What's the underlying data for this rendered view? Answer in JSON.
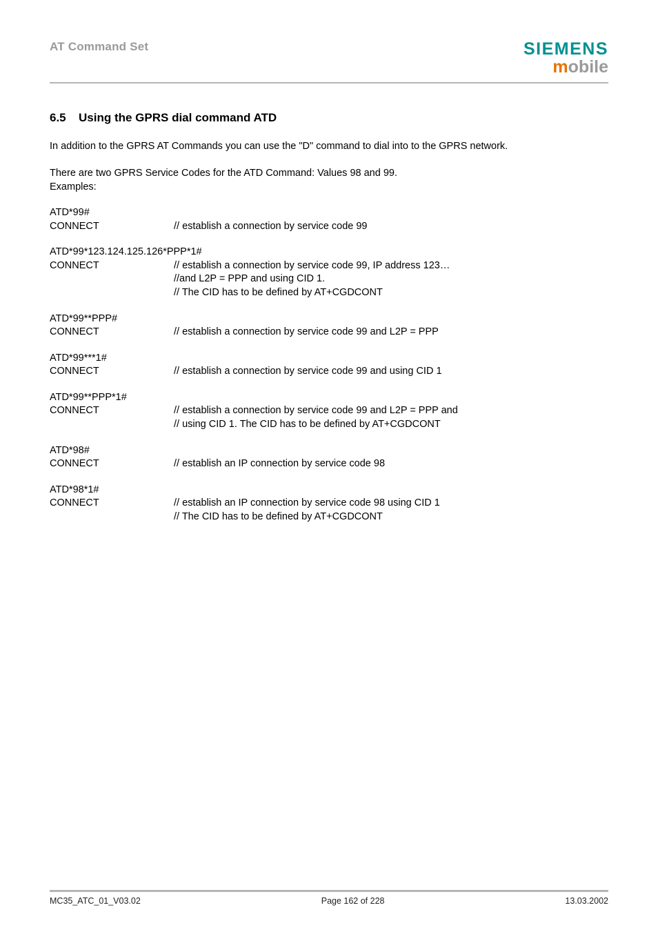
{
  "header": {
    "title": "AT Command Set",
    "logo_top": "SIEMENS",
    "logo_m": "m",
    "logo_rest": "obile"
  },
  "section": {
    "number": "6.5",
    "title": "Using the GPRS dial command ATD"
  },
  "intro": "In addition to the GPRS AT Commands you can use the \"D\" command to dial into to the GPRS network.",
  "note_line1": "There are two GPRS Service Codes for the ATD Command: Values 98 and 99.",
  "note_line2": "Examples:",
  "examples": [
    {
      "cmd": "ATD*99#",
      "rows": [
        {
          "left": "CONNECT",
          "right": "// establish a connection by service code 99"
        }
      ]
    },
    {
      "cmd": "ATD*99*123.124.125.126*PPP*1#",
      "rows": [
        {
          "left": "CONNECT",
          "right": "// establish a connection by service code 99, IP address 123…"
        },
        {
          "left": "",
          "right": "//and L2P = PPP and using CID 1."
        },
        {
          "left": "",
          "right": "// The CID has to be defined by AT+CGDCONT"
        }
      ]
    },
    {
      "cmd": "ATD*99**PPP#",
      "rows": [
        {
          "left": "CONNECT",
          "right": "// establish a connection by service code 99 and L2P = PPP"
        }
      ]
    },
    {
      "cmd": "ATD*99***1#",
      "rows": [
        {
          "left": "CONNECT",
          "right": "// establish a connection by service code 99 and using CID 1"
        }
      ]
    },
    {
      "cmd": "ATD*99**PPP*1#",
      "rows": [
        {
          "left": "CONNECT",
          "right": "// establish a connection by service code 99 and L2P = PPP and"
        },
        {
          "left": "",
          "right": "// using CID 1. The CID has to be defined by AT+CGDCONT"
        }
      ]
    },
    {
      "cmd": "ATD*98#",
      "rows": [
        {
          "left": "CONNECT",
          "right": "// establish an IP connection by service code 98"
        }
      ]
    },
    {
      "cmd": "ATD*98*1#",
      "rows": [
        {
          "left": "CONNECT",
          "right": "// establish an IP connection by service code 98 using CID 1"
        },
        {
          "left": "",
          "right": "// The CID has to be defined by AT+CGDCONT"
        }
      ]
    }
  ],
  "footer": {
    "left": "MC35_ATC_01_V03.02",
    "center": "Page 162 of 228",
    "right": "13.03.2002"
  }
}
